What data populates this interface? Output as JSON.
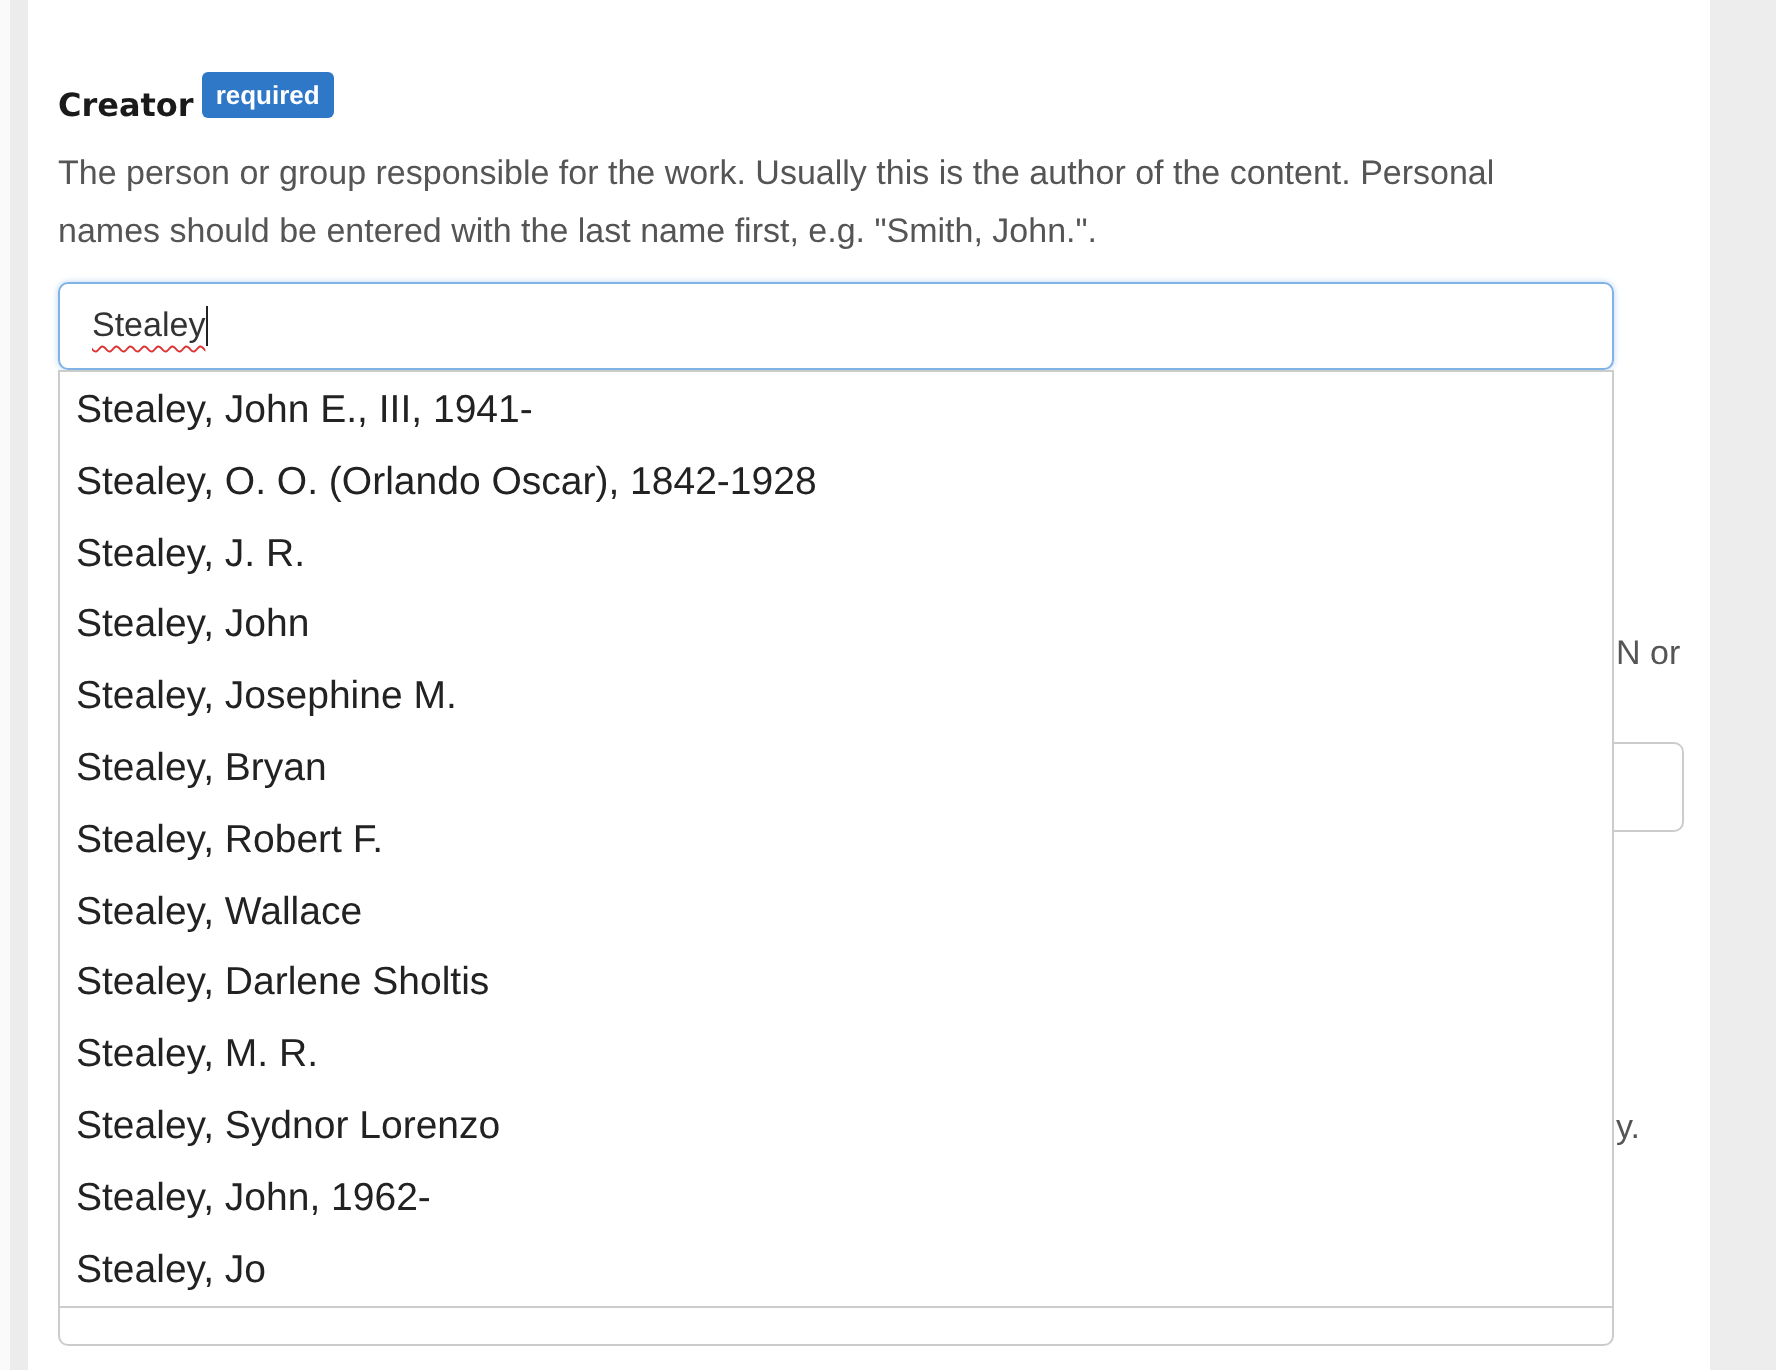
{
  "field": {
    "label": "Creator",
    "badge": "required",
    "description": "The person or group responsible for the work. Usually this is the author of the content. Personal names should be entered with the last name first, e.g. \"Smith, John.\".",
    "value": "Stealey"
  },
  "suggestions": [
    "Stealey, John E., III, 1941-",
    "Stealey, O. O. (Orlando Oscar), 1842-1928",
    "Stealey, J. R.",
    "Stealey, John",
    "Stealey, Josephine M.",
    "Stealey, Bryan",
    "Stealey, Robert F.",
    "Stealey, Wallace",
    "Stealey, Darlene Sholtis",
    "Stealey, M. R.",
    "Stealey, Sydnor Lorenzo",
    "Stealey, John, 1962-",
    "Stealey, Jo"
  ],
  "background_texts": [
    "N or",
    "y."
  ]
}
